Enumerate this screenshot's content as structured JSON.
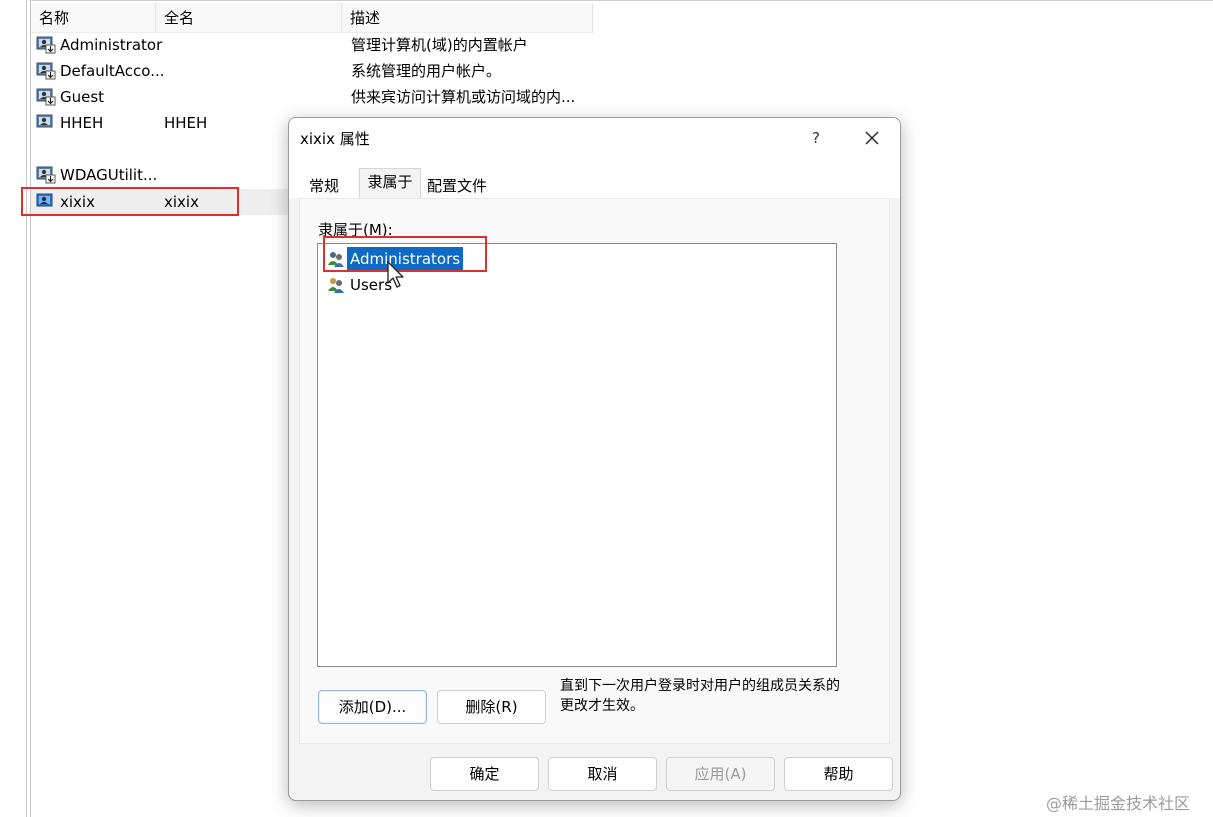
{
  "list": {
    "columns": [
      "名称",
      "全名",
      "描述"
    ],
    "rows": [
      {
        "name": "Administrator",
        "full": "",
        "desc": "管理计算机(域)的内置帐户"
      },
      {
        "name": "DefaultAcco...",
        "full": "",
        "desc": "系统管理的用户帐户。"
      },
      {
        "name": "Guest",
        "full": "",
        "desc": "供来宾访问计算机或访问域的内..."
      },
      {
        "name": "HHEH",
        "full": "HHEH",
        "desc": ""
      },
      {
        "name": "WDAGUtilit...",
        "full": "",
        "desc": ""
      },
      {
        "name": "xixix",
        "full": "xixix",
        "desc": ""
      }
    ]
  },
  "dialog": {
    "title": "xixix 属性",
    "help": "?",
    "tabs": [
      "常规",
      "隶属于",
      "配置文件"
    ],
    "member_label": "隶属于(M):",
    "members": [
      "Administrators",
      "Users"
    ],
    "add_button": "添加(D)...",
    "remove_button": "删除(R)",
    "note": "直到下一次用户登录时对用户的组成员关系的更改才生效。",
    "ok_button": "确定",
    "cancel_button": "取消",
    "apply_button": "应用(A)",
    "help_button": "帮助"
  },
  "watermark": "@稀土掘金技术社区",
  "colors": {
    "highlight_box": "#d9312d",
    "selection": "#0e6bc5"
  }
}
